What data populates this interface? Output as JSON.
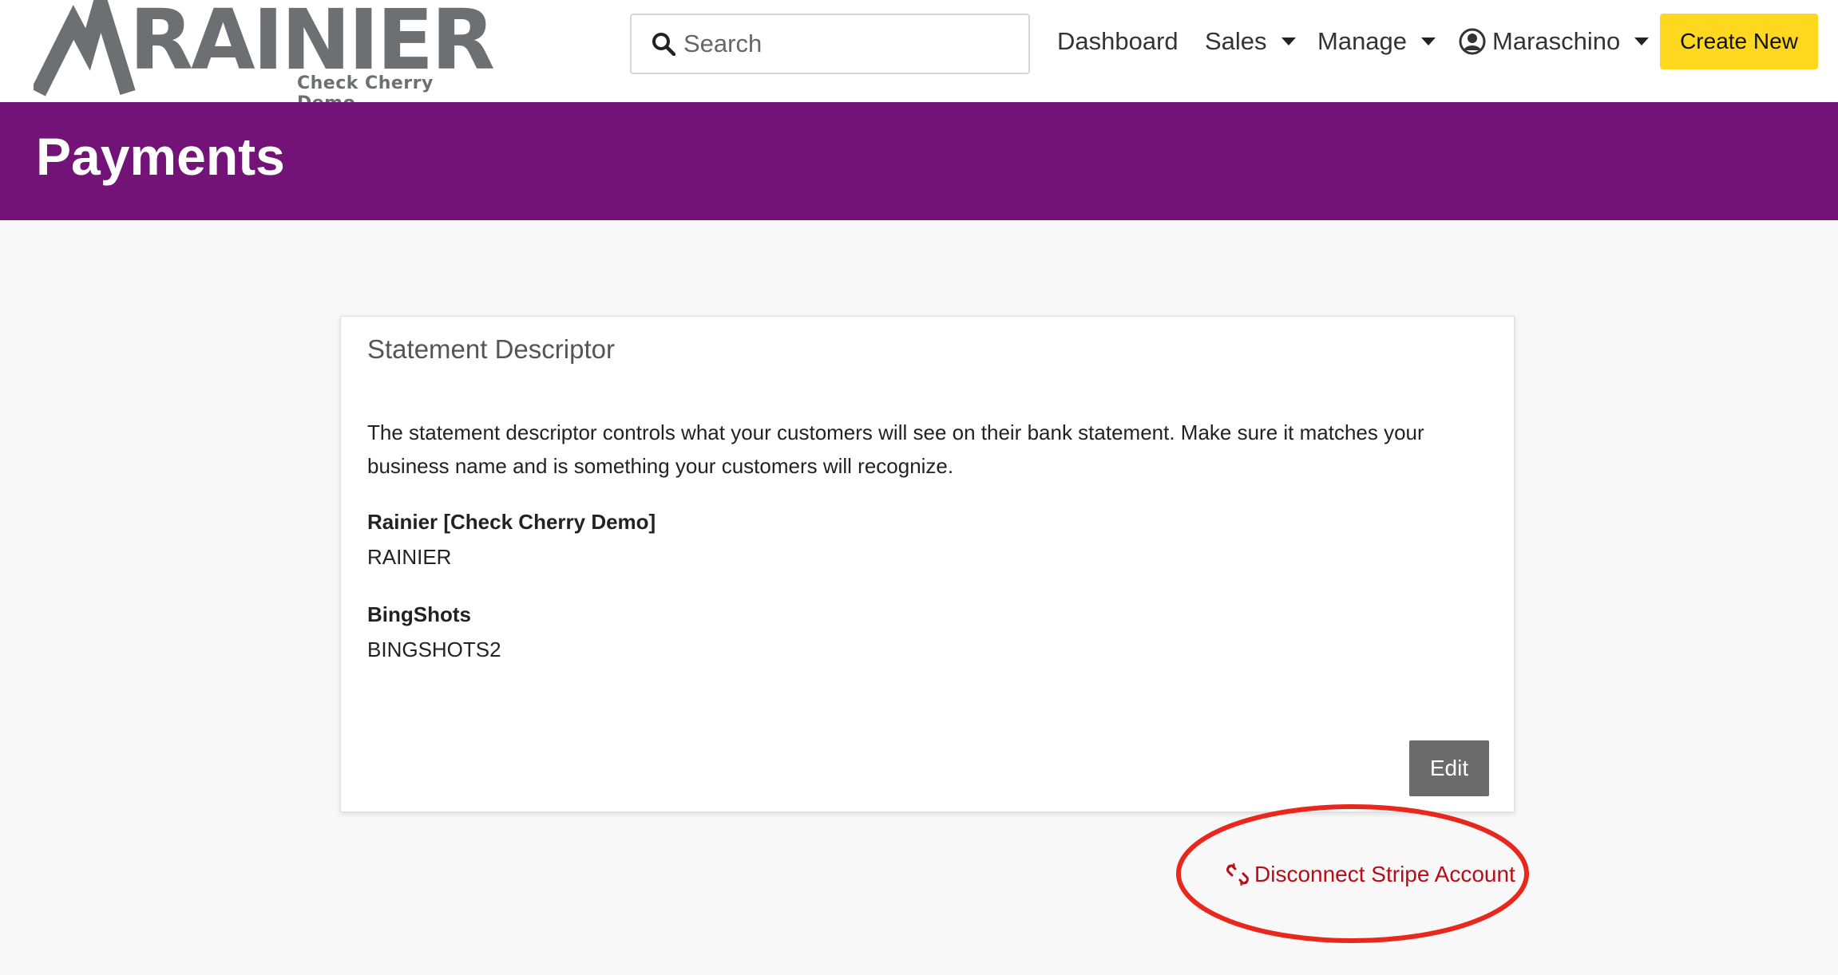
{
  "brand": {
    "name": "RAINIER",
    "subtitle": "Check Cherry Demo"
  },
  "search": {
    "placeholder": "Search"
  },
  "nav": {
    "dashboard": "Dashboard",
    "sales": "Sales",
    "manage": "Manage",
    "user": "Maraschino",
    "create_new": "Create New"
  },
  "header": {
    "title": "Payments"
  },
  "card": {
    "title": "Statement Descriptor",
    "description": "The statement descriptor controls what your customers will see on their bank statement. Make sure it matches your business name and is something your customers will recognize.",
    "descriptors": [
      {
        "name": "Rainier [Check Cherry Demo]",
        "value": "RAINIER"
      },
      {
        "name": "BingShots",
        "value": "BINGSHOTS2"
      }
    ],
    "edit_label": "Edit"
  },
  "disconnect": {
    "label": "Disconnect Stripe Account"
  },
  "colors": {
    "header_bg": "#731378",
    "create_button": "#fdd81e",
    "edit_button": "#6b6b6b",
    "disconnect_text": "#b80d17",
    "annotation_circle": "#e8271d"
  },
  "icons": {
    "search": "search-icon",
    "user": "user-circle-icon",
    "unlink": "unlink-icon",
    "caret": "chevron-down-icon"
  }
}
